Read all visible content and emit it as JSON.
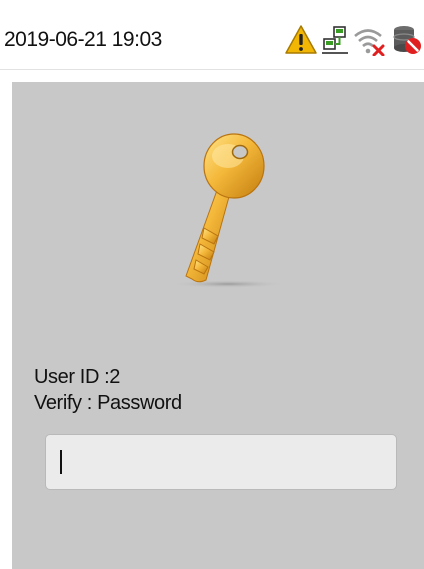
{
  "status_bar": {
    "datetime": "2019-06-21 19:03",
    "icons": [
      "warning-icon",
      "network-icon",
      "wifi-disconnected-icon",
      "server-disconnected-icon"
    ]
  },
  "verify_screen": {
    "icon": "key-icon",
    "user_id_text": "User ID :2",
    "verify_text": "Verify : Password",
    "password_input": {
      "value": "",
      "placeholder": ""
    }
  },
  "colors": {
    "panel_bg": "#c8c8c8",
    "input_bg": "#ebebeb",
    "warning": "#f2b705",
    "network": "#3a9d23",
    "error": "#e02020",
    "key_gold": "#f0b93c"
  }
}
